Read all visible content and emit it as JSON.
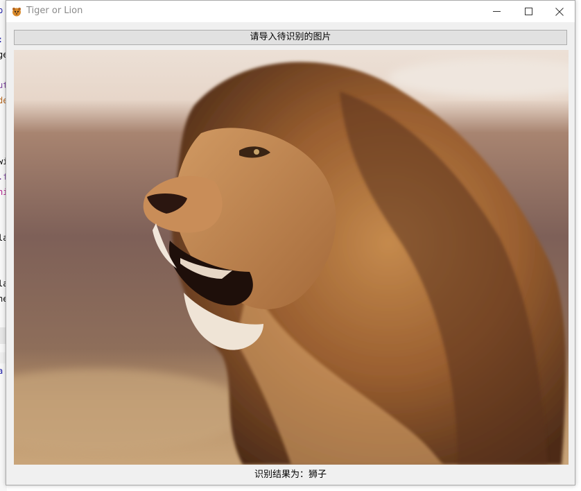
{
  "window": {
    "title": "Tiger or Lion",
    "controls": {
      "minimize_icon": "minimize-icon",
      "maximize_icon": "maximize-icon",
      "close_icon": "close-icon"
    }
  },
  "toolbar": {
    "import_button_label": "请导入待识别的图片"
  },
  "image": {
    "subject": "lion"
  },
  "result": {
    "text": "识别结果为：狮子"
  },
  "background_editor": {
    "fragments": [
      {
        "text": "p",
        "color": "#1a1aa6"
      },
      {
        "text": ":",
        "color": "#1a1aa6"
      },
      {
        "text": "ge",
        "color": "#000000"
      },
      {
        "text": "ut",
        "color": "#7a3e9d"
      },
      {
        "text": "de",
        "color": "#b5651d"
      },
      {
        "text": "wi",
        "color": "#000000"
      },
      {
        "text": ".f",
        "color": "#7a3e9d"
      },
      {
        "text": "ni",
        "color": "#b0158a"
      },
      {
        "text": "la",
        "color": "#000000"
      },
      {
        "text": "la",
        "color": "#000000"
      },
      {
        "text": "ne",
        "color": "#000000"
      },
      {
        "text": "a",
        "color": "#1a1aa6"
      }
    ]
  },
  "colors": {
    "window_bg": "#f0f0f0",
    "button_bg": "#e1e1e1",
    "button_border": "#adadad",
    "titlebar_bg": "#ffffff",
    "title_text": "#8a8a8a"
  }
}
